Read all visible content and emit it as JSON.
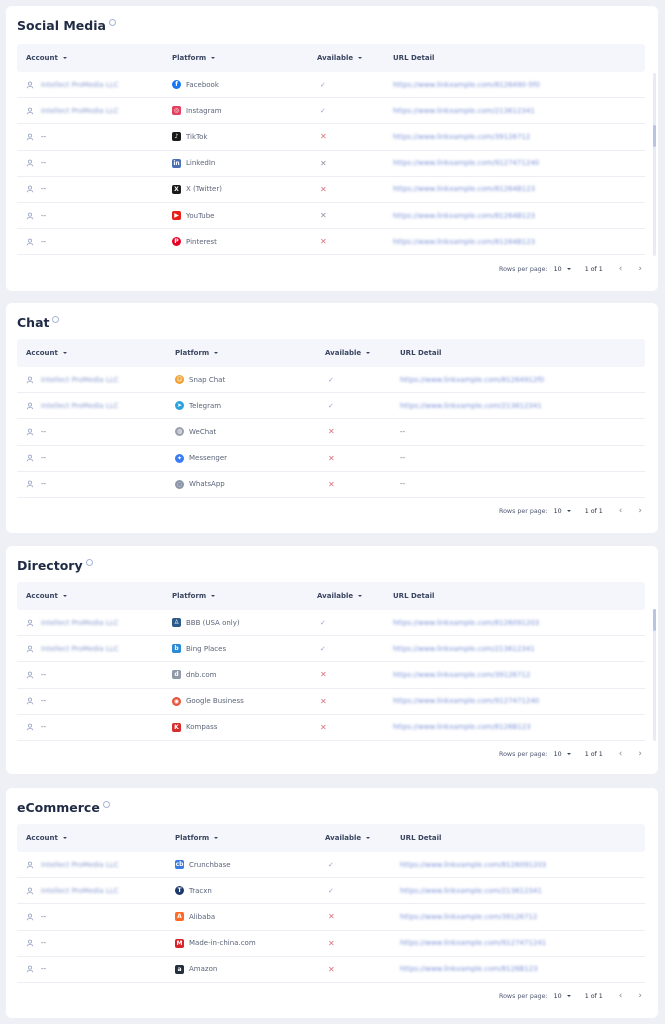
{
  "sections": [
    {
      "title": "Social Media",
      "headers": {
        "account": "Account",
        "platform": "Platform",
        "available": "Available",
        "url": "URL Detail"
      },
      "rows": [
        {
          "account": "Intellect ProMedia LLC",
          "platform": "Facebook",
          "icon": "facebook-icon",
          "available": "check",
          "url": "https://www.linkxample.com/8126490-5f0",
          "blur": true
        },
        {
          "account": "Intellect ProMedia LLC",
          "platform": "Instagram",
          "icon": "instagram-icon",
          "available": "check",
          "url": "https://www.linkxample.com/213612341",
          "blur": true
        },
        {
          "account": "--",
          "platform": "TikTok",
          "icon": "tiktok-icon",
          "available": "cross",
          "url": "https://www.linkxample.com/39126712",
          "blur": false
        },
        {
          "account": "--",
          "platform": "LinkedIn",
          "icon": "linkedin-icon",
          "available": "cross",
          "url": "https://www.linkxample.com/9127471240",
          "blur": false
        },
        {
          "account": "--",
          "platform": "X (Twitter)",
          "icon": "x-twitter-icon",
          "available": "cross",
          "url": "https://www.linkxample.com/81264B123",
          "blur": false
        },
        {
          "account": "--",
          "platform": "YouTube",
          "icon": "youtube-icon",
          "available": "cross",
          "url": "https://www.linkxample.com/81264B123",
          "blur": false
        },
        {
          "account": "--",
          "platform": "Pinterest",
          "icon": "pinterest-icon",
          "available": "cross",
          "url": "https://www.linkxample.com/81264B123",
          "blur": false
        }
      ],
      "pager": {
        "rows_label": "Rows per page:",
        "rows_value": "10",
        "range": "1 of 1",
        "prev": "‹",
        "next": "›"
      }
    },
    {
      "title": "Chat",
      "headers": {
        "account": "Account",
        "platform": "Platform",
        "available": "Available",
        "url": "URL Detail"
      },
      "rows": [
        {
          "account": "Intellect ProMedia LLC",
          "platform": "Snap Chat",
          "icon": "snapchat-icon",
          "available": "check",
          "url": "https://www.linkxample.com/81264912f0",
          "blur": true
        },
        {
          "account": "Intellect ProMedia LLC",
          "platform": "Telegram",
          "icon": "telegram-icon",
          "available": "check",
          "url": "https://www.linkxample.com/213612341",
          "blur": true
        },
        {
          "account": "--",
          "platform": "WeChat",
          "icon": "wechat-icon",
          "available": "cross",
          "url": "--",
          "blur": false
        },
        {
          "account": "--",
          "platform": "Messenger",
          "icon": "messenger-icon",
          "available": "cross",
          "url": "--",
          "blur": false
        },
        {
          "account": "--",
          "platform": "WhatsApp",
          "icon": "whatsapp-icon",
          "available": "cross",
          "url": "--",
          "blur": false
        }
      ],
      "pager": {
        "rows_label": "Rows per page:",
        "rows_value": "10",
        "range": "1 of 1",
        "prev": "‹",
        "next": "›"
      }
    },
    {
      "title": "Directory",
      "headers": {
        "account": "Account",
        "platform": "Platform",
        "available": "Available",
        "url": "URL Detail"
      },
      "rows": [
        {
          "account": "Intellect ProMedia LLC",
          "platform": "BBB (USA only)",
          "icon": "bbb-icon",
          "available": "check",
          "url": "https://www.linkxample.com/8126091203",
          "blur": true
        },
        {
          "account": "Intellect ProMedia LLC",
          "platform": "Bing Places",
          "icon": "bing-icon",
          "available": "check",
          "url": "https://www.linkxample.com/213612341",
          "blur": true
        },
        {
          "account": "--",
          "platform": "dnb.com",
          "icon": "dnb-icon",
          "available": "cross",
          "url": "https://www.linkxample.com/39126712",
          "blur": false
        },
        {
          "account": "--",
          "platform": "Google Business",
          "icon": "google-business-icon",
          "available": "cross",
          "url": "https://www.linkxample.com/9127471240",
          "blur": false
        },
        {
          "account": "--",
          "platform": "Kompass",
          "icon": "kompass-icon",
          "available": "cross",
          "url": "https://www.linkxample.com/8126B123",
          "blur": false
        }
      ],
      "pager": {
        "rows_label": "Rows per page:",
        "rows_value": "10",
        "range": "1 of 1",
        "prev": "‹",
        "next": "›"
      }
    },
    {
      "title": "eCommerce",
      "headers": {
        "account": "Account",
        "platform": "Platform",
        "available": "Available",
        "url": "URL Detail"
      },
      "rows": [
        {
          "account": "Intellect ProMedia LLC",
          "platform": "Crunchbase",
          "icon": "crunchbase-icon",
          "available": "check",
          "url": "https://www.linkxample.com/8126091203",
          "blur": true
        },
        {
          "account": "Intellect ProMedia LLC",
          "platform": "Tracxn",
          "icon": "tracxn-icon",
          "available": "check",
          "url": "https://www.linkxample.com/213612341",
          "blur": true
        },
        {
          "account": "--",
          "platform": "Alibaba",
          "icon": "alibaba-icon",
          "available": "cross",
          "url": "https://www.linkxample.com/39126712",
          "blur": false
        },
        {
          "account": "--",
          "platform": "Made-in-china.com",
          "icon": "made-in-china-icon",
          "available": "cross",
          "url": "https://www.linkxample.com/9127471241",
          "blur": false
        },
        {
          "account": "--",
          "platform": "Amazon",
          "icon": "amazon-icon",
          "available": "cross",
          "url": "https://www.linkxample.com/8126B123",
          "blur": false
        }
      ],
      "pager": {
        "rows_label": "Rows per page:",
        "rows_value": "10",
        "range": "1 of 1",
        "prev": "‹",
        "next": "›"
      }
    }
  ]
}
